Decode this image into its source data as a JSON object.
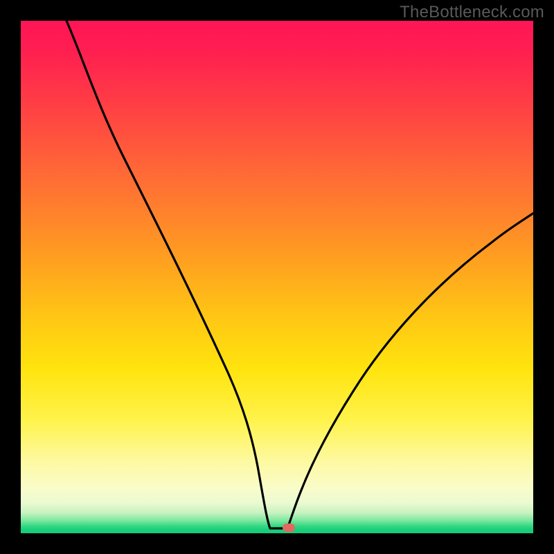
{
  "watermark": "TheBottleneck.com",
  "colors": {
    "page_background": "#000000",
    "watermark_text": "#595959",
    "curve_stroke": "#000000",
    "marker_fill": "#e2695f",
    "gradient_top": "#ff1556",
    "gradient_bottom": "#16ce79"
  },
  "chart_data": {
    "type": "line",
    "title": "",
    "xlabel": "",
    "ylabel": "",
    "xlim": [
      0,
      100
    ],
    "ylim": [
      0,
      100
    ],
    "grid": false,
    "legend": false,
    "background": "vertical_gradient_red_to_green",
    "note": "Axis values are percentage of the plot area. Curve traced from pixels; y=0 is bottom (green), y=100 is top (red). Single V-shaped curve with minimum near x≈52 at y≈0, and a short flat bottom from x≈48 to x≈52.",
    "series": [
      {
        "name": "curve",
        "x": [
          9,
          12,
          16,
          20,
          24,
          28,
          32,
          36,
          40,
          44,
          46,
          48,
          50,
          52,
          54,
          57,
          60,
          64,
          70,
          76,
          84,
          92,
          99
        ],
        "y": [
          100,
          92,
          83,
          73,
          65,
          57,
          49,
          41,
          32,
          21,
          14,
          3,
          1,
          1,
          3,
          9,
          15,
          22,
          31,
          38,
          46,
          53,
          59
        ]
      }
    ],
    "marker": {
      "x": 52,
      "y": 0.5,
      "shape": "rounded-rect",
      "color": "#e2695f"
    }
  }
}
